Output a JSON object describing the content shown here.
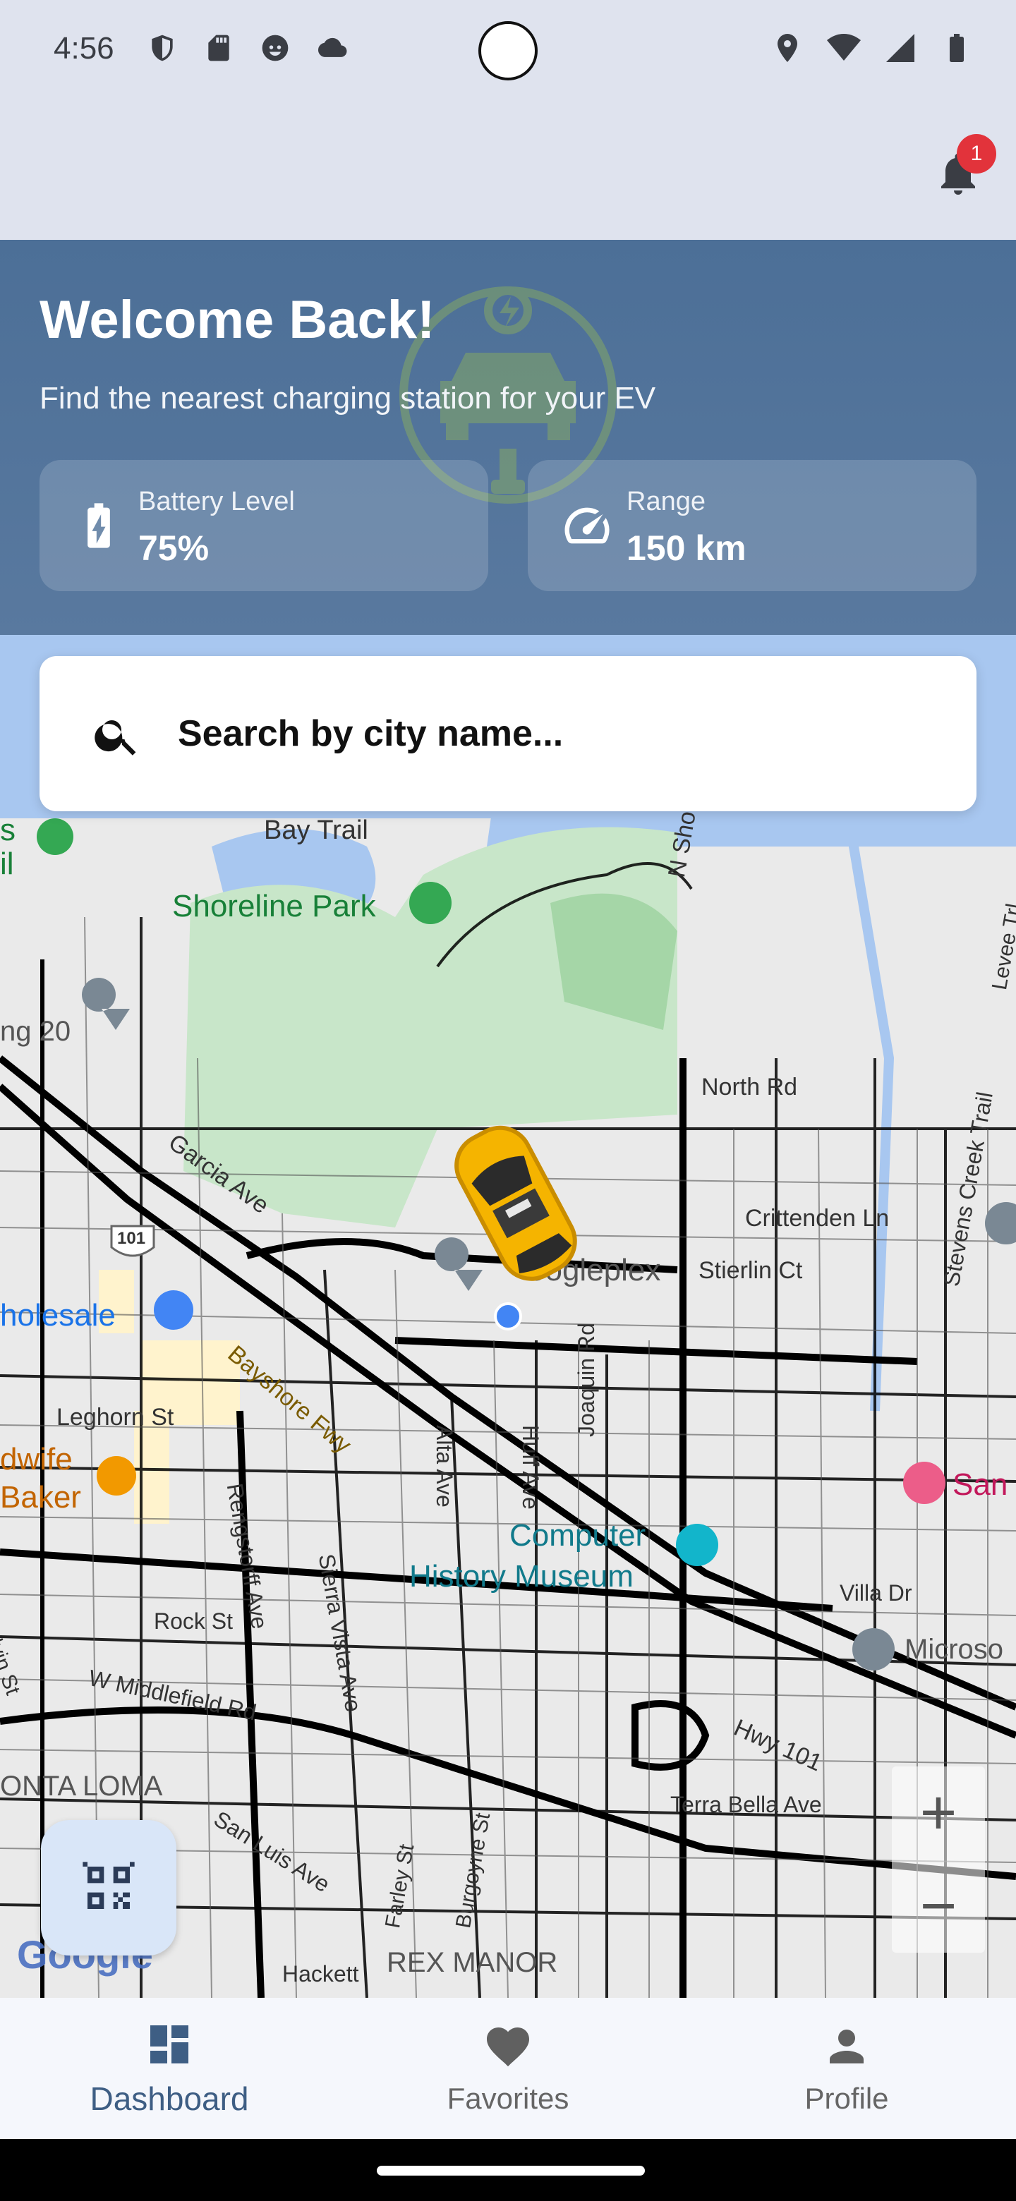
{
  "status_bar": {
    "time": "4:56",
    "left_icons": [
      "shield-icon",
      "sd-card-icon",
      "face-icon",
      "cloud-icon"
    ],
    "right_icons": [
      "location-icon",
      "wifi-icon",
      "signal-icon",
      "battery-icon"
    ]
  },
  "header": {
    "notification_count": "1"
  },
  "hero": {
    "title": "Welcome Back!",
    "subtitle": "Find the nearest charging station for your EV",
    "battery": {
      "label": "Battery Level",
      "value": "75%"
    },
    "range": {
      "label": "Range",
      "value": "150 km"
    }
  },
  "search": {
    "placeholder": "Search by city name..."
  },
  "map": {
    "labels": {
      "bay_trail": "Bay Trail",
      "shoreline_park": "Shoreline Park",
      "n_shoreline": "N Shoreline Blvd",
      "north_rd": "North Rd",
      "crittenden": "Crittenden Ln",
      "stierlin": "Stierlin Ct",
      "stevens_creek": "Stevens Creek Trail",
      "levee": "Levee Trl",
      "garcia": "Garcia Ave",
      "wholesale": "holesale",
      "bayshore": "Bayshore Fwy",
      "googleplex": "oogleplex",
      "leghorn": "Leghorn St",
      "dwife": "dwife",
      "baker": "Baker",
      "alta": "Alta Ave",
      "huff": "Huff Ave",
      "joaquin": "Joaquin Rd",
      "computer": "Computer",
      "history": "History Museum",
      "sierra": "Sierra Vista Ave",
      "rengstorff": "Rengstorff Ave",
      "rock": "Rock St",
      "middlefield": "W Middlefield Rd",
      "villa": "Villa Dr",
      "micros": "Microso",
      "san": "San",
      "hwy101": "Hwy 101",
      "terra": "Terra Bella Ave",
      "monta_loma": "ONTA LOMA",
      "san_luis": "San Luis Ave",
      "farley": "Farley St",
      "burgoyne": "Burgoyne St",
      "rex_manor": "REX MANOR",
      "hackett": "Hackett",
      "altvin": "Alvin St",
      "ng20": "ng 20",
      "shield101": "101",
      "s_label": "s",
      "il_label": "il"
    },
    "zoom_in": "+",
    "zoom_out": "−",
    "attribution": "Google"
  },
  "nav": {
    "items": [
      {
        "label": "Dashboard",
        "icon": "dashboard-icon",
        "active": true
      },
      {
        "label": "Favorites",
        "icon": "heart-icon",
        "active": false
      },
      {
        "label": "Profile",
        "icon": "person-icon",
        "active": false
      }
    ]
  },
  "colors": {
    "hero": "#4c6f97",
    "nav_active": "#3e5e84",
    "badge": "#e2333b",
    "fab": "#d9e6f8"
  }
}
